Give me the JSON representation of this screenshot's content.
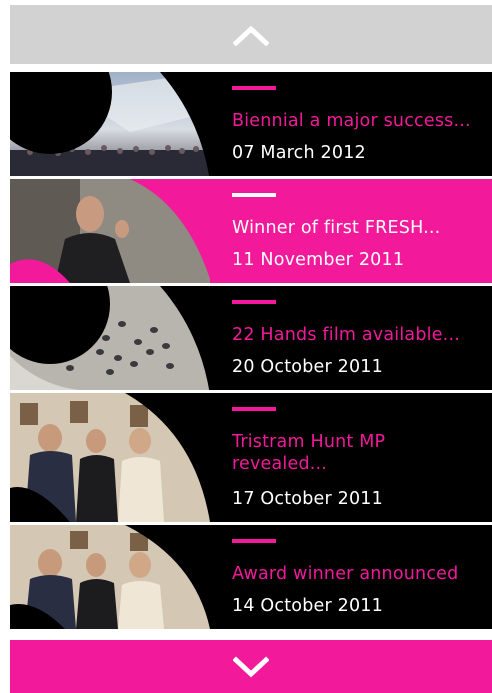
{
  "nav": {
    "up_icon": "chevron-up-icon",
    "down_icon": "chevron-down-icon"
  },
  "colors": {
    "accent": "#f21a9a",
    "item_bg": "#000000",
    "nav_up_bg": "#d2d2d2",
    "text_white": "#ffffff"
  },
  "news": [
    {
      "title": "Biennial a major success...",
      "date": "07 March 2012",
      "active": false
    },
    {
      "title": "Winner of first FRESH...",
      "date": "11 November 2011",
      "active": true
    },
    {
      "title": "22 Hands film available...",
      "date": "20 October 2011",
      "active": false
    },
    {
      "title": "Tristram Hunt MP revealed...",
      "date": "17 October 2011",
      "active": false
    },
    {
      "title": "Award winner announced",
      "date": "14 October 2011",
      "active": false
    }
  ]
}
